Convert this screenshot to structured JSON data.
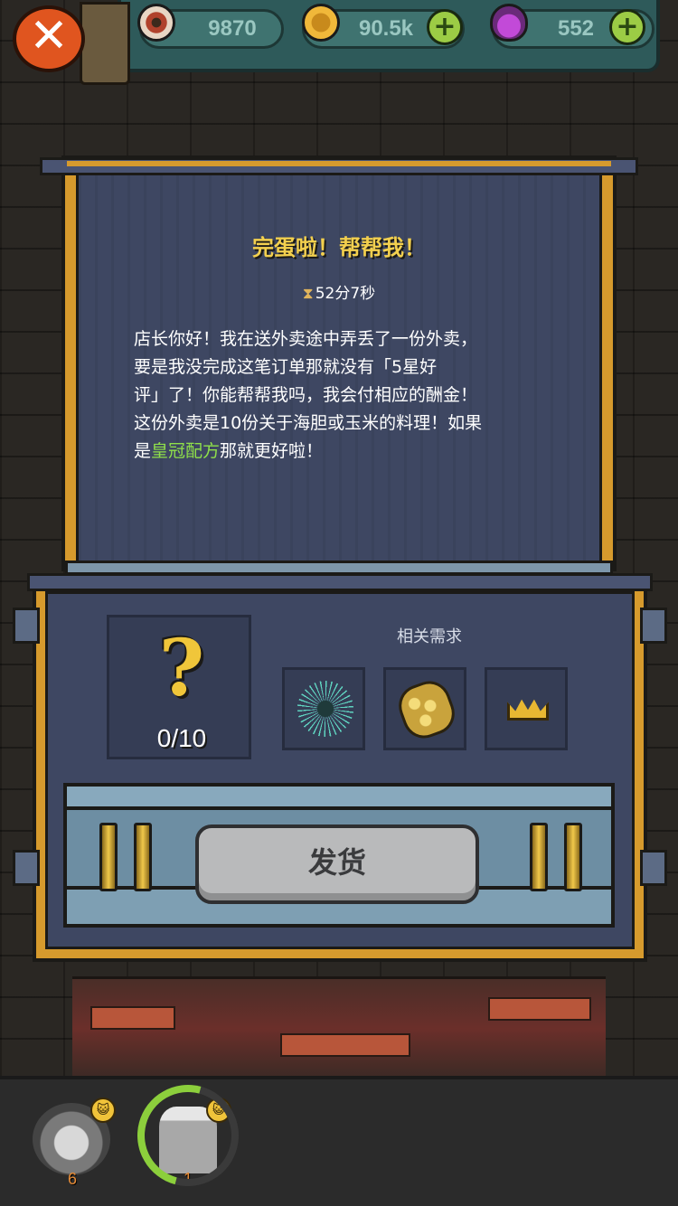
{
  "currencies": [
    {
      "name": "eyeball",
      "value": "9870",
      "has_add": false
    },
    {
      "name": "coin",
      "value": "90.5k",
      "has_add": true
    },
    {
      "name": "potion",
      "value": "552",
      "has_add": true
    }
  ],
  "add_button_label": "+",
  "close_label": "✕",
  "quest": {
    "title": "完蛋啦！帮帮我！",
    "timer": "52分7秒",
    "message_lines": [
      "店长你好！我在送外卖途中弄丢了一份外卖，",
      "要是我没完成这笔订单那就没有「5星好",
      "评」了！你能帮帮我吗，我会付相应的酬金！",
      "这份外卖是10份关于海胆或玉米的料理！如果"
    ],
    "message_last_prefix": "是",
    "message_highlight": "皇冠配方",
    "message_last_suffix": "那就更好啦！",
    "highlight_color": "#8fe04a"
  },
  "delivery": {
    "unknown_item_glyph": "?",
    "progress": "0/10",
    "requirements_label": "相关需求",
    "requirements": [
      "sea-urchin",
      "corn",
      "crown"
    ],
    "ship_button": "发货"
  },
  "tray": [
    {
      "name": "urchin-dish",
      "count": "6",
      "badge": "😺"
    },
    {
      "name": "stump-dish",
      "count": "1",
      "badge": "😺"
    }
  ],
  "colors": {
    "accent_gold": "#d69a2d",
    "title_yellow": "#f3d04e",
    "panel_blue": "#3e4762",
    "plus_green": "#9ccc45",
    "close_orange": "#e0551f"
  }
}
